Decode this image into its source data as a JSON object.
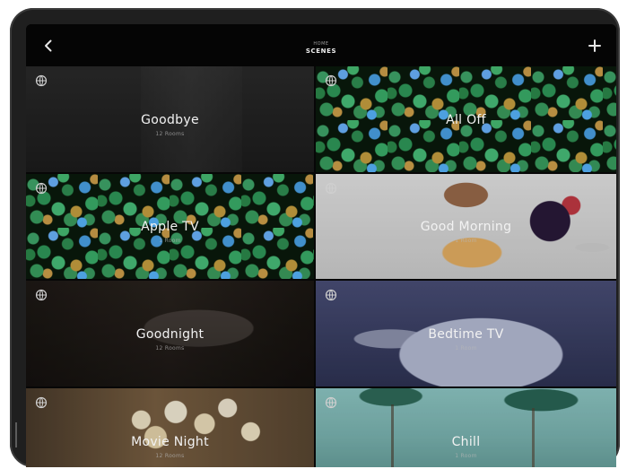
{
  "header": {
    "breadcrumb": "HOME",
    "title": "SCENES",
    "back_icon": "chevron-left-icon",
    "add_icon": "plus-icon"
  },
  "tiles": [
    {
      "name": "Goodbye",
      "sub": "12 Rooms"
    },
    {
      "name": "All Off",
      "sub": ""
    },
    {
      "name": "Apple TV",
      "sub": "1 Room"
    },
    {
      "name": "Good Morning",
      "sub": "1 Room"
    },
    {
      "name": "Goodnight",
      "sub": "12 Rooms"
    },
    {
      "name": "Bedtime TV",
      "sub": "1 Room"
    },
    {
      "name": "Movie Night",
      "sub": "12 Rooms"
    },
    {
      "name": "Chill",
      "sub": "1 Room"
    }
  ],
  "icons": {
    "tile_icon": "globe-icon"
  }
}
